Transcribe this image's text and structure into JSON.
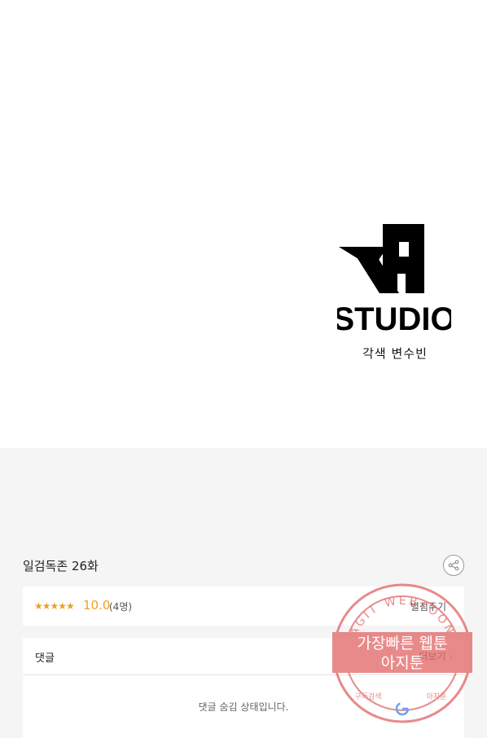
{
  "artwork": {
    "logo_text": "STUDIO",
    "credit": "각색 변수빈"
  },
  "episode": {
    "title": "일검독존 26화"
  },
  "rating": {
    "stars": "★★★★★",
    "score": "10.0",
    "count": "(4명)",
    "rate_label": "별점주기"
  },
  "comments": {
    "label": "댓글",
    "more_label": "더보기",
    "hidden_message": "댓글 숨김 상태입니다."
  },
  "watermark": {
    "ring_text": "AGIT WEBTOON",
    "line1": "가장빠른 웹툰",
    "line2": "아지툰",
    "bottom_left": "구독검색",
    "bottom_right": "아지툰",
    "color": "#e36a6a"
  },
  "colors": {
    "accent": "#f0a020",
    "background": "#f5f5f5"
  }
}
